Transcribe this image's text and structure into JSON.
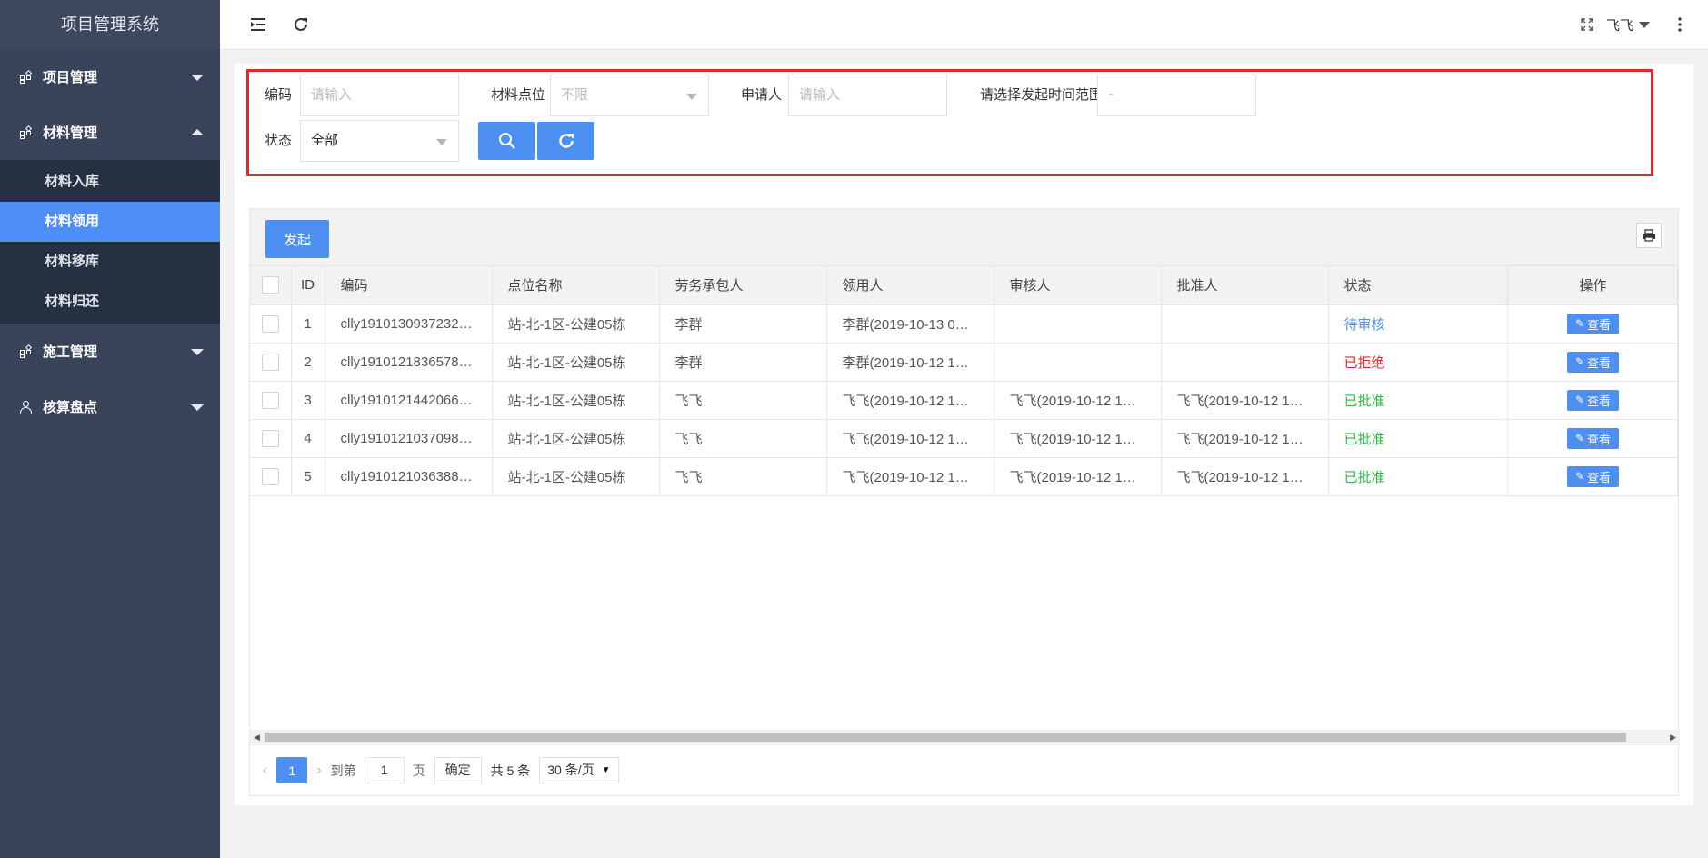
{
  "app": {
    "title": "项目管理系统"
  },
  "sidebar": {
    "groups": [
      {
        "label": "项目管理",
        "expanded": false
      },
      {
        "label": "材料管理",
        "expanded": true,
        "items": [
          "材料入库",
          "材料领用",
          "材料移库",
          "材料归还"
        ],
        "active": "材料领用"
      },
      {
        "label": "施工管理",
        "expanded": false
      },
      {
        "label": "核算盘点",
        "expanded": false
      }
    ]
  },
  "header": {
    "username": "飞飞"
  },
  "filters": {
    "code_label": "编码",
    "code_placeholder": "请输入",
    "location_label": "材料点位",
    "location_value": "不限",
    "applicant_label": "申请人",
    "applicant_placeholder": "请输入",
    "daterange_label": "请选择发起时间范围",
    "daterange_value": "~",
    "status_label": "状态",
    "status_value": "全部"
  },
  "toolbar": {
    "launch_label": "发起"
  },
  "table": {
    "columns": [
      "ID",
      "编码",
      "点位名称",
      "劳务承包人",
      "领用人",
      "审核人",
      "批准人",
      "状态",
      "操作"
    ],
    "rows": [
      {
        "id": "1",
        "code": "clly1910130937232…",
        "location": "站-北-1区-公建05栋",
        "contractor": "李群",
        "receiver": "李群(2019-10-13 0…",
        "reviewer": "",
        "approver": "",
        "status": "待审核",
        "status_type": "pending"
      },
      {
        "id": "2",
        "code": "clly1910121836578…",
        "location": "站-北-1区-公建05栋",
        "contractor": "李群",
        "receiver": "李群(2019-10-12 1…",
        "reviewer": "",
        "approver": "",
        "status": "已拒绝",
        "status_type": "reject"
      },
      {
        "id": "3",
        "code": "clly1910121442066…",
        "location": "站-北-1区-公建05栋",
        "contractor": "飞飞",
        "receiver": "飞飞(2019-10-12 1…",
        "reviewer": "飞飞(2019-10-12 1…",
        "approver": "飞飞(2019-10-12 1…",
        "status": "已批准",
        "status_type": "ok"
      },
      {
        "id": "4",
        "code": "clly1910121037098…",
        "location": "站-北-1区-公建05栋",
        "contractor": "飞飞",
        "receiver": "飞飞(2019-10-12 1…",
        "reviewer": "飞飞(2019-10-12 1…",
        "approver": "飞飞(2019-10-12 1…",
        "status": "已批准",
        "status_type": "ok"
      },
      {
        "id": "5",
        "code": "clly1910121036388…",
        "location": "站-北-1区-公建05栋",
        "contractor": "飞飞",
        "receiver": "飞飞(2019-10-12 1…",
        "reviewer": "飞飞(2019-10-12 1…",
        "approver": "飞飞(2019-10-12 1…",
        "status": "已批准",
        "status_type": "ok"
      }
    ],
    "view_label": "查看"
  },
  "pager": {
    "current_page": "1",
    "goto_label": "到第",
    "goto_value": "1",
    "page_unit": "页",
    "confirm_label": "确定",
    "total_label": "共 5 条",
    "page_size": "30 条/页"
  },
  "colors": {
    "accent": "#4e8ff2",
    "sidebar_bg": "#394359",
    "sidebar_sub_bg": "#263043",
    "danger": "#e8262a",
    "success": "#2fb944"
  }
}
